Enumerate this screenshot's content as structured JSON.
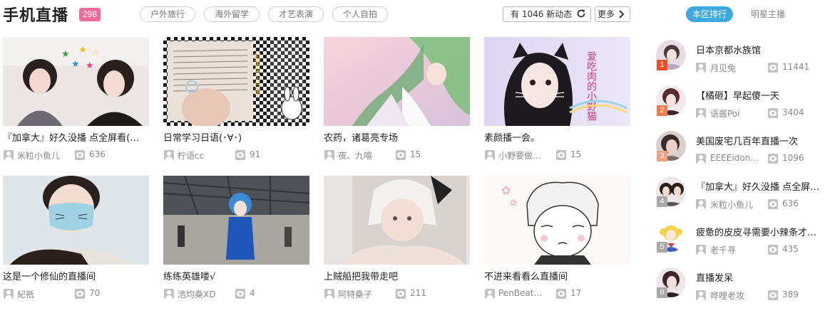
{
  "header": {
    "title": "手机直播",
    "count": "298",
    "tags": [
      "户外旅行",
      "海外留学",
      "才艺表演",
      "个人自拍"
    ],
    "refresh_label": "有 1046 新动态",
    "more_label": "更多"
  },
  "cards": [
    {
      "title": "『加拿大』好久没播 点全屏看(…",
      "user": "米粒小鱼儿",
      "views": "636",
      "art": "girls",
      "art_text": ""
    },
    {
      "title": "日常学习日语(･∀･)",
      "user": "柠语cc",
      "views": "91",
      "art": "notebook",
      "art_text": "刻苦学习日语"
    },
    {
      "title": "农药，诸葛亮专场",
      "user": "夜、九嘻",
      "views": "15",
      "art": "anime",
      "art_text": ""
    },
    {
      "title": "素颜播一会。",
      "user": "小野要做…",
      "views": "15",
      "art": "catgirl",
      "art_text": "爱吃肉的小野猫"
    },
    {
      "title": "这是一个修仙的直播间",
      "user": "紀祇",
      "views": "70",
      "art": "guitar",
      "art_text": ""
    },
    {
      "title": "练练英雄喽√",
      "user": "浩均桑XD",
      "views": "4",
      "art": "cosplay",
      "art_text": ""
    },
    {
      "title": "上贼船把我带走吧",
      "user": "阿特桑子",
      "views": "211",
      "art": "white",
      "art_text": ""
    },
    {
      "title": "不进来看看么直播间",
      "user": "PenBeate…",
      "views": "17",
      "art": "chibi",
      "art_text": ""
    }
  ],
  "sidebar": {
    "tabs": [
      "本区排行",
      "明星主播"
    ],
    "active_tab": 0,
    "ranking": [
      {
        "rank": "1",
        "title": "日本京都水族馆",
        "user": "月见兔",
        "views": "11441",
        "color": "#f04e23"
      },
      {
        "rank": "2",
        "title": "【橘砸】早起傻一天",
        "user": "语酱Poi",
        "views": "3404",
        "color": "#f47b4f"
      },
      {
        "rank": "3",
        "title": "美国废宅几百年直播一次",
        "user": "EEEEidon…",
        "views": "1096",
        "color": "#f4a07f"
      },
      {
        "rank": "4",
        "title": "『加拿大』好久没播 点全屏…",
        "user": "米粒小鱼儿",
        "views": "636",
        "color": "#a8a8a8"
      },
      {
        "rank": "5",
        "title": "疲惫的皮皮寻需要小辣条才…",
        "user": "老千寻",
        "views": "435",
        "color": "#a8a8a8"
      },
      {
        "rank": "6",
        "title": "直播发呆",
        "user": "哗哩老攻",
        "views": "389",
        "color": "#a8a8a8"
      }
    ]
  },
  "icons": {
    "user": "user-icon",
    "views": "eye-icon",
    "refresh": "refresh-icon",
    "more": "chevron-right-icon"
  },
  "colors": {
    "badge": "#f06b9b",
    "active_tab": "#3da9de",
    "rank1": "#f04e23",
    "rank2": "#f47b4f",
    "rank3": "#f4a07f"
  }
}
